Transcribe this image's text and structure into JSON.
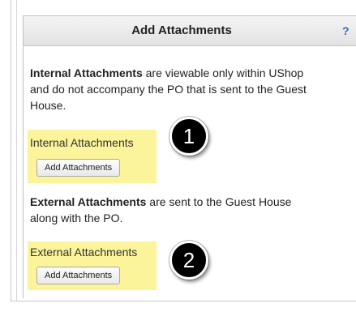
{
  "panel": {
    "title": "Add Attachments",
    "help_icon_label": "?"
  },
  "internal": {
    "heading_bold": "Internal Attachments",
    "description_rest_line1": " are viewable only within UShop",
    "description_line2": "and do not accompany the PO that is sent to the Guest",
    "description_line3": "House.",
    "section_label": "Internal Attachments",
    "button_label": "Add Attachments",
    "badge_number": "1"
  },
  "external": {
    "heading_bold": "External Attachments",
    "description_rest_line1": " are sent to the Guest House",
    "description_line2": "along with the PO.",
    "section_label": "External Attachments",
    "button_label": "Add Attachments",
    "badge_number": "2"
  },
  "colors": {
    "highlight": "#fbf49a",
    "help_icon": "#2f6eb5",
    "badge": "#000000"
  }
}
